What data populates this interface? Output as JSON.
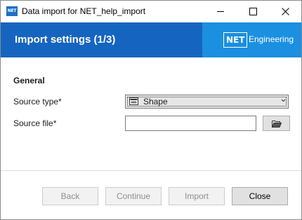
{
  "window": {
    "title": "Data import for NET_help_import",
    "app_icon_text": "NET"
  },
  "banner": {
    "title": "Import settings (1/3)",
    "brand_box": "NET",
    "brand_text": "Engineering",
    "colors": {
      "banner": "#1565c0",
      "brand": "#1b8fe0"
    }
  },
  "form": {
    "section_title": "General",
    "source_type": {
      "label": "Source type*",
      "value": "Shape",
      "icon": "shapefile-icon"
    },
    "source_file": {
      "label": "Source file*",
      "value": "",
      "browse_icon": "folder-open-icon"
    }
  },
  "footer": {
    "back_label": "Back",
    "continue_label": "Continue",
    "import_label": "Import",
    "close_label": "Close"
  }
}
